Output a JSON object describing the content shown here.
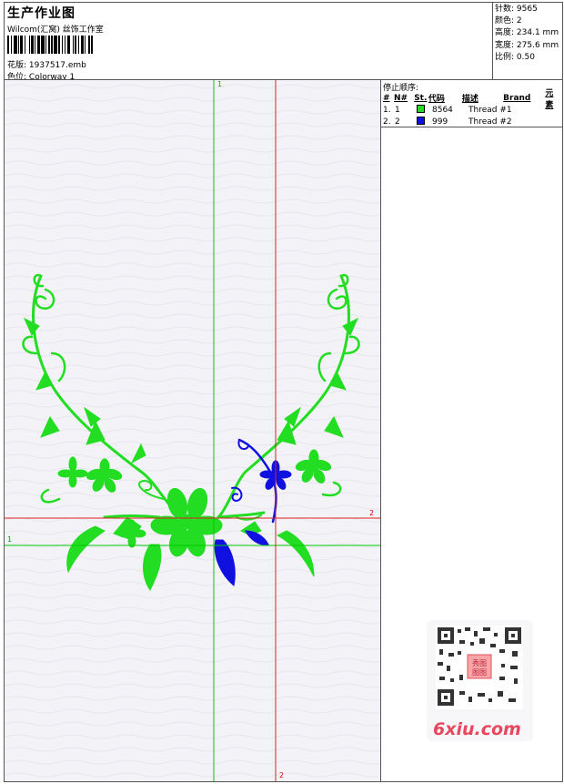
{
  "header": {
    "title": "生产作业图",
    "subtitle": "Wilcom(汇窝) 丝饰工作室",
    "file_label": "花版:",
    "file_value": "1937517.emb",
    "colorway_label": "色位:",
    "colorway_value": "Colorway 1"
  },
  "stats": [
    {
      "label": "针数:",
      "value": "9565"
    },
    {
      "label": "颜色:",
      "value": "2"
    },
    {
      "label": "高度:",
      "value": "234.1 mm"
    },
    {
      "label": "宽度:",
      "value": "275.6 mm"
    },
    {
      "label": "比例:",
      "value": "0.50"
    }
  ],
  "stop_sequence": {
    "title": "停止顺序:",
    "columns": [
      "#",
      "N#",
      "St.",
      "代码",
      "描述",
      "Brand",
      "元素"
    ],
    "rows": [
      {
        "index": "1.",
        "n": "1",
        "color": "#22dd22",
        "code": "8564",
        "description": "Thread #1"
      },
      {
        "index": "2.",
        "n": "2",
        "color": "#1010e0",
        "code": "999",
        "description": "Thread #2"
      }
    ]
  },
  "guides": {
    "green_vertical_label": "1",
    "green_horizontal_label": "1",
    "red_horizontal_label": "2",
    "red_vertical_label": "2"
  },
  "colors": {
    "green_thread": "#22dd22",
    "blue_thread": "#1010e0",
    "green_guide": "#00cc00",
    "red_guide": "#dd2020",
    "canvas": "#f3f2f7"
  },
  "watermark": {
    "qr_icon": "qr-code-icon",
    "brand": "6xiu.com",
    "seal_text": "秀图图图"
  }
}
